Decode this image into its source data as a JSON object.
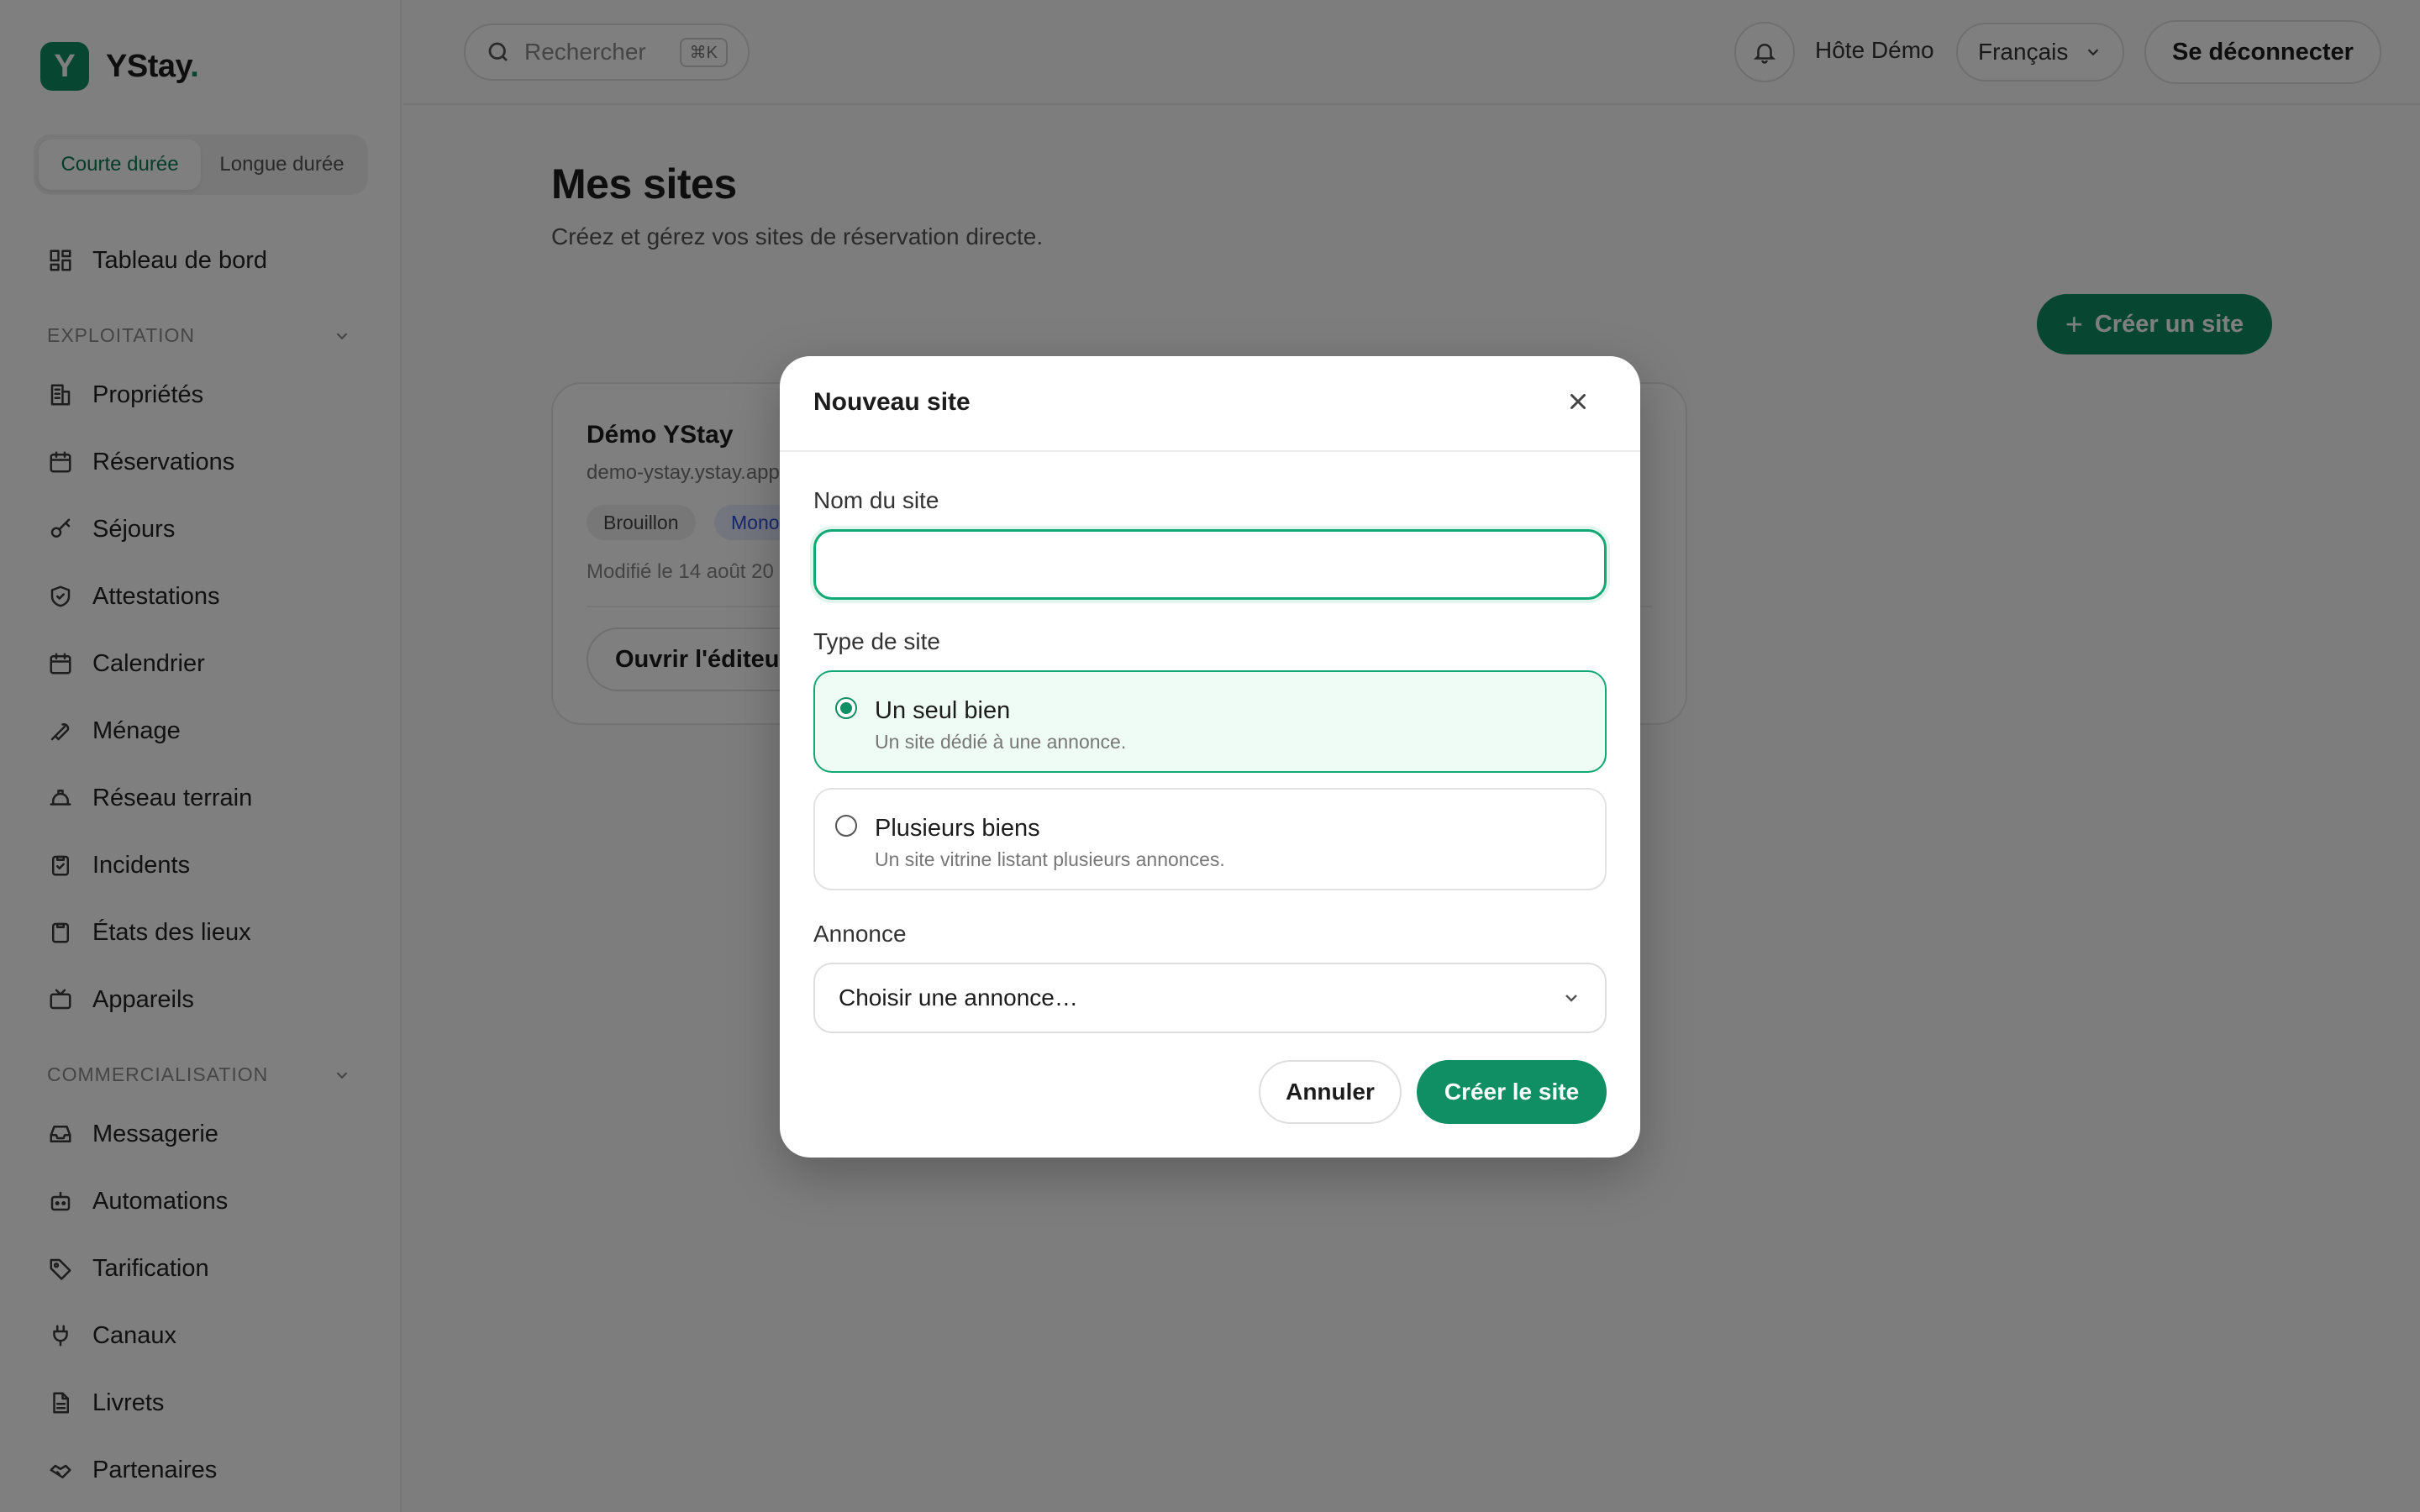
{
  "brand": {
    "name": "YStay",
    "dot": ".",
    "logo_letter": "Y",
    "accent": "#0f8f63"
  },
  "mode_toggle": {
    "short": "Courte durée",
    "long": "Longue durée",
    "active": "Courte durée"
  },
  "sidebar": {
    "dashboard": "Tableau de bord",
    "section_exploitation": "EXPLOITATION",
    "exploitation_items": [
      "Propriétés",
      "Réservations",
      "Séjours",
      "Attestations",
      "Calendrier",
      "Ménage",
      "Réseau terrain",
      "Incidents",
      "États des lieux",
      "Appareils"
    ],
    "section_commercialisation": "COMMERCIALISATION",
    "commercialisation_items": [
      "Messagerie",
      "Automations",
      "Tarification",
      "Canaux",
      "Livrets",
      "Partenaires"
    ]
  },
  "header": {
    "search_placeholder": "Rechercher",
    "search_shortcut": "⌘K",
    "host_name": "Hôte Démo",
    "language": "Français",
    "logout": "Se déconnecter"
  },
  "main": {
    "title": "Mes sites",
    "subtitle": "Créez et gérez vos sites de réservation directe.",
    "create_button": "Créer un site",
    "card": {
      "title": "Démo YStay",
      "url": "demo-ystay.ystay.app",
      "badge_status": "Brouillon",
      "badge_type": "Mono",
      "modified": "Modifié le 14 août 20",
      "open_editor": "Ouvrir l'éditeur"
    }
  },
  "modal": {
    "title": "Nouveau site",
    "name_label": "Nom du site",
    "name_value": "",
    "type_label": "Type de site",
    "options": [
      {
        "title": "Un seul bien",
        "desc": "Un site dédié à une annonce.",
        "selected": true
      },
      {
        "title": "Plusieurs biens",
        "desc": "Un site vitrine listant plusieurs annonces.",
        "selected": false
      }
    ],
    "listing_label": "Annonce",
    "listing_placeholder": "Choisir une annonce…",
    "cancel": "Annuler",
    "submit": "Créer le site"
  }
}
